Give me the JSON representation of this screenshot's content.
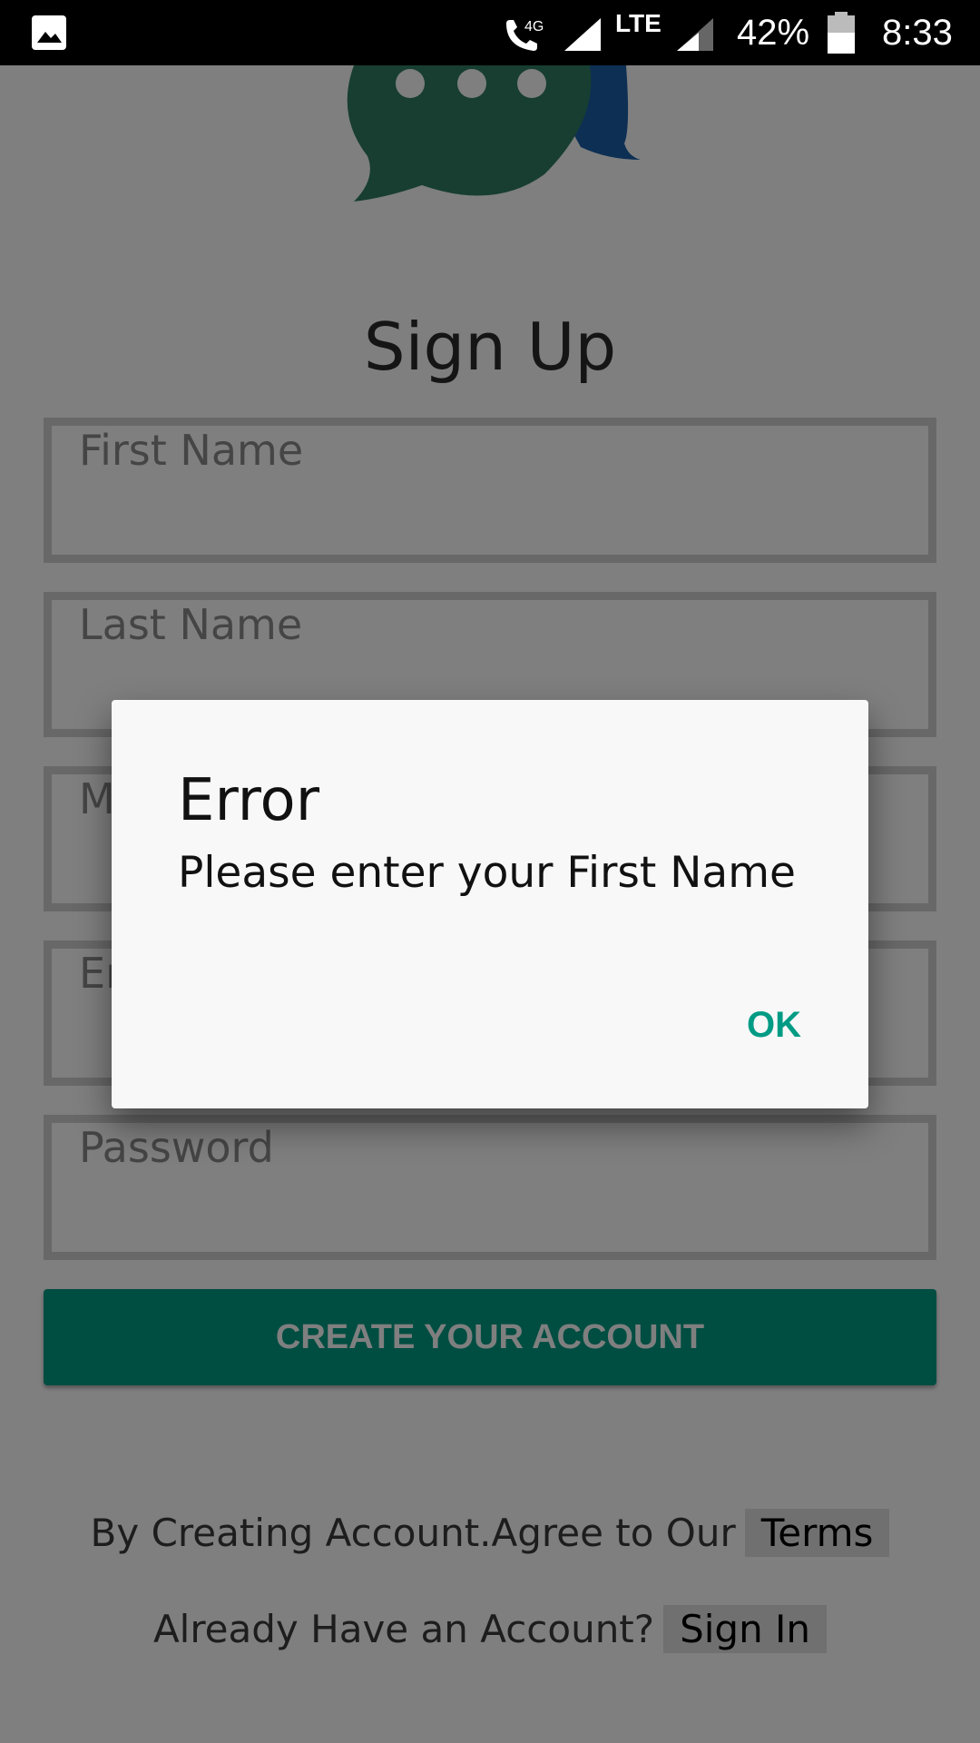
{
  "status_bar": {
    "notification_icon": "gallery-icon",
    "network_label": "4G",
    "lte_label": "LTE",
    "battery_percent": "42%",
    "time": "8:33"
  },
  "logo": {
    "icon": "chat-bubbles-icon"
  },
  "page": {
    "title": "Sign Up"
  },
  "form": {
    "first_name_placeholder": "First Name",
    "last_name_placeholder": "Last Name",
    "middle_placeholder": "M",
    "email_placeholder": "Er",
    "password_placeholder": "Password",
    "create_button_label": "CREATE YOUR ACCOUNT"
  },
  "footer": {
    "terms_text": "By Creating Account.Agree to Our",
    "terms_link": "Terms",
    "signin_text": "Already Have an Account?",
    "signin_link": "Sign In"
  },
  "dialog": {
    "title": "Error",
    "message": "Please enter your First Name",
    "ok_label": "OK"
  },
  "colors": {
    "accent": "#009b84",
    "logo_green": "#2e7d62",
    "logo_blue": "#1a5fa8",
    "scrim": "rgba(0,0,0,0.5)"
  }
}
